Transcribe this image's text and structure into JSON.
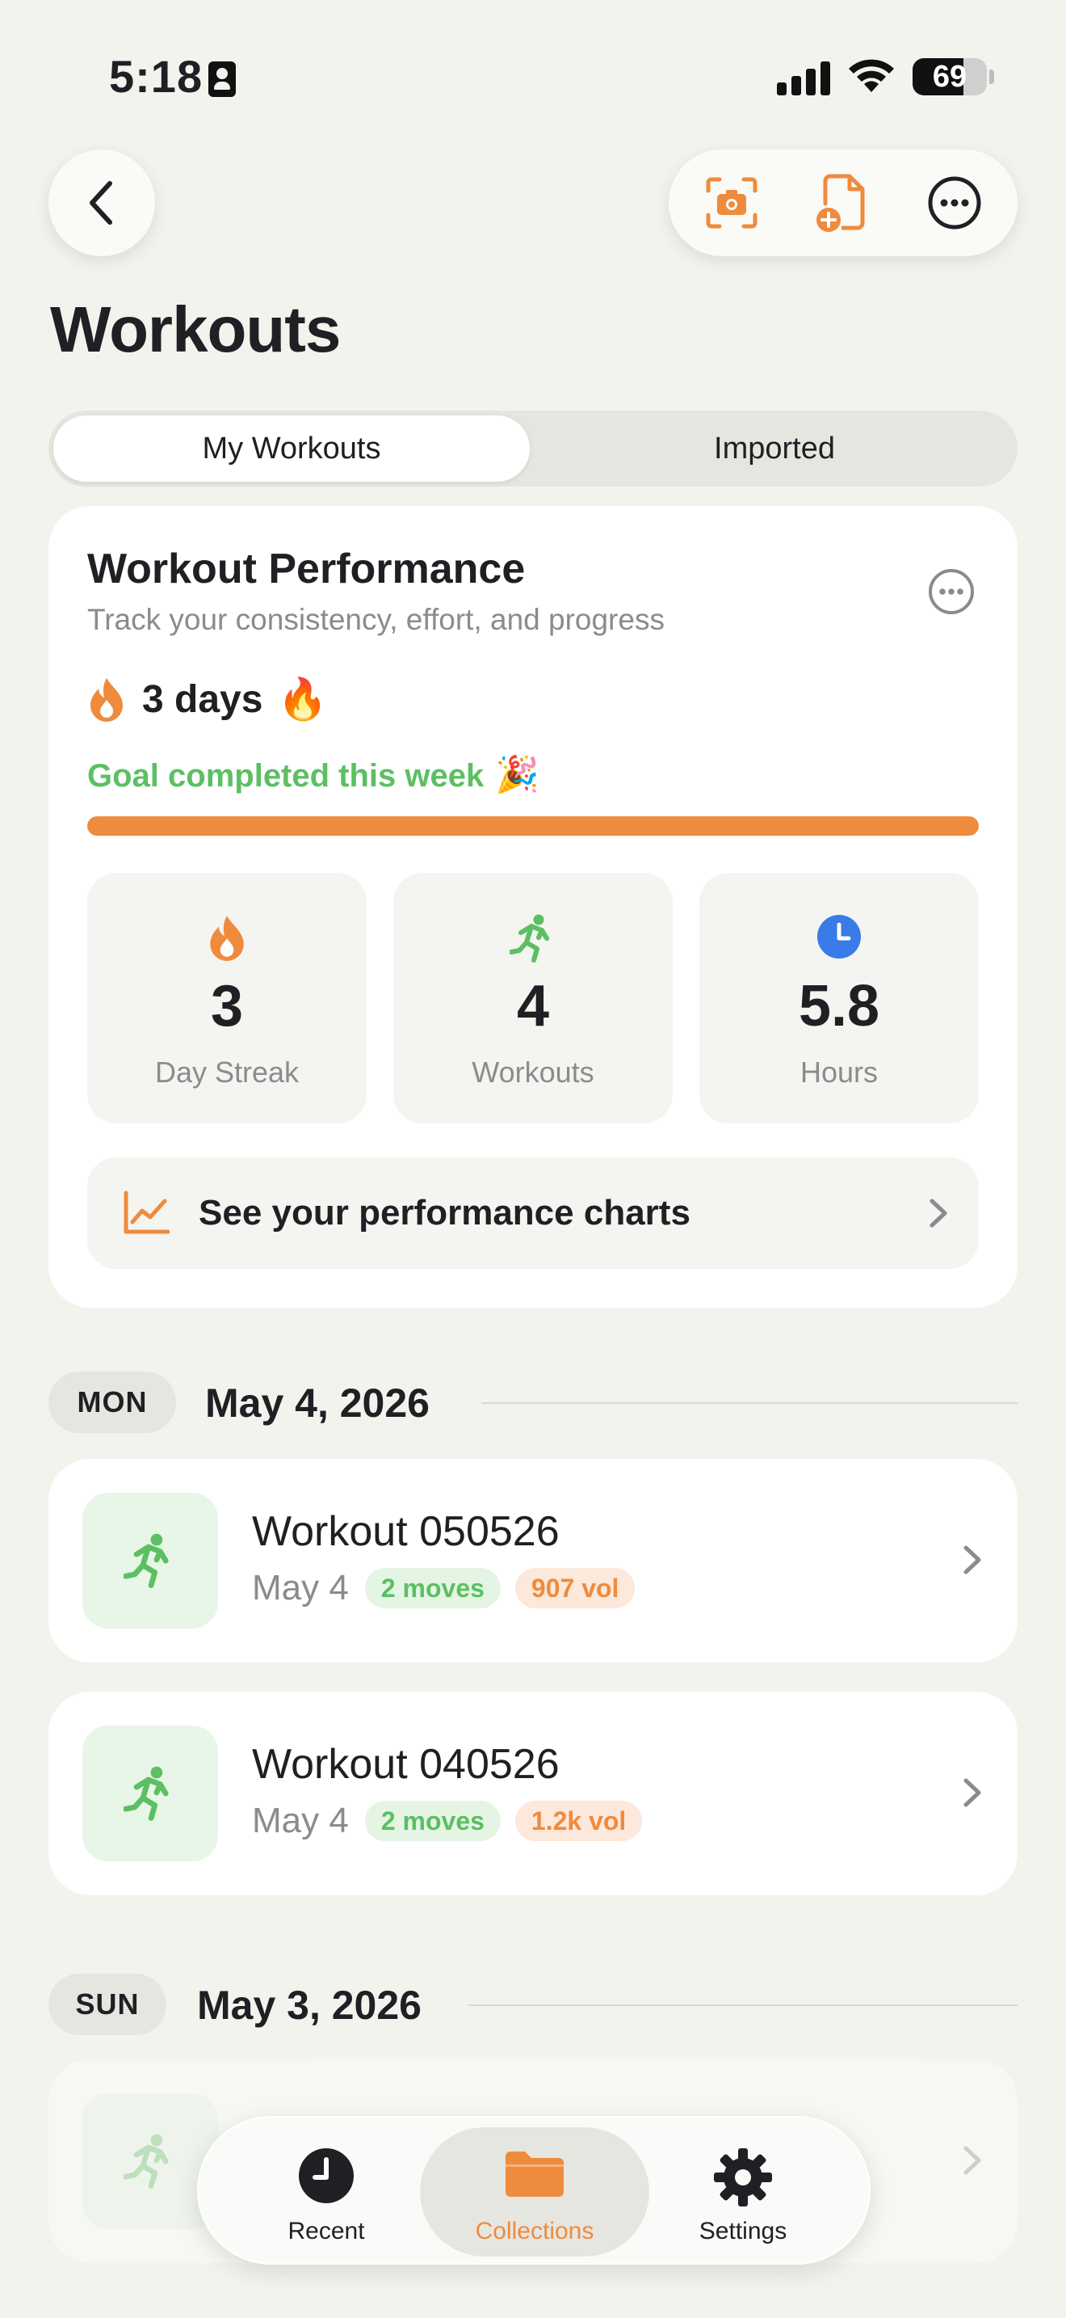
{
  "status_bar": {
    "time": "5:18",
    "battery": "69",
    "battery_level": 0.69
  },
  "page": {
    "title": "Workouts"
  },
  "segments": [
    {
      "label": "My Workouts",
      "selected": true
    },
    {
      "label": "Imported",
      "selected": false
    }
  ],
  "performance": {
    "title": "Workout Performance",
    "subtitle": "Track your consistency, effort, and progress",
    "streak_text": "3 days",
    "streak_emoji": "🔥",
    "goal_text": "Goal completed this week",
    "goal_emoji": "🎉",
    "goal_progress": 1.0,
    "stats": [
      {
        "value": "3",
        "label": "Day Streak",
        "icon": "flame-icon"
      },
      {
        "value": "4",
        "label": "Workouts",
        "icon": "runner-icon"
      },
      {
        "value": "5.8",
        "label": "Hours",
        "icon": "clock-icon"
      }
    ],
    "charts_link": "See your performance charts"
  },
  "days": [
    {
      "badge": "MON",
      "date": "May 4, 2026",
      "workouts": [
        {
          "name": "Workout 050526",
          "date": "May 4",
          "moves": "2 moves",
          "volume": "907 vol"
        },
        {
          "name": "Workout 040526",
          "date": "May 4",
          "moves": "2 moves",
          "volume": "1.2k vol"
        }
      ]
    },
    {
      "badge": "SUN",
      "date": "May 3, 2026",
      "workouts": []
    }
  ],
  "tabbar": [
    {
      "label": "Recent",
      "icon": "clock-icon",
      "selected": false
    },
    {
      "label": "Collections",
      "icon": "folder-icon",
      "selected": true
    },
    {
      "label": "Settings",
      "icon": "gear-icon",
      "selected": false
    }
  ],
  "colors": {
    "accent": "#ef8b3c",
    "green": "#5cbf62",
    "blue": "#3a7be8",
    "background": "#f3f3ee"
  }
}
